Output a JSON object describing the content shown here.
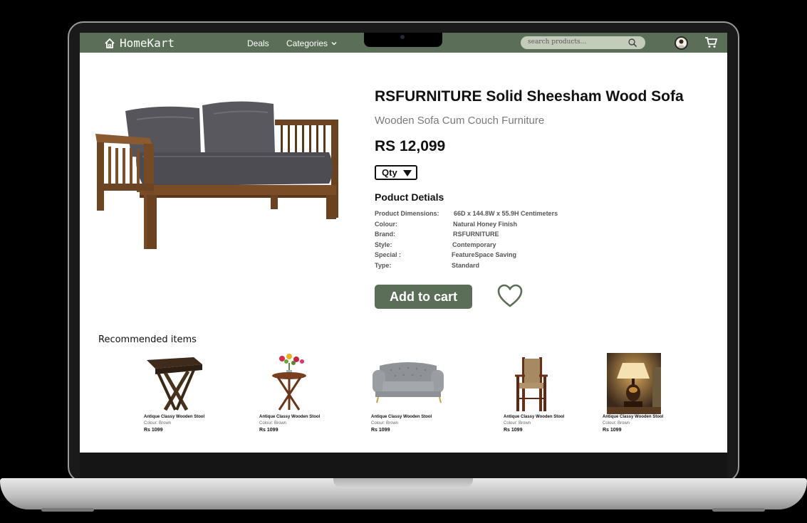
{
  "nav": {
    "brand": "HomeKart",
    "links": [
      "Deals",
      "Categories"
    ],
    "search_placeholder": "search products...",
    "colors": {
      "nav_bg": "#5b6e57",
      "search_bg": "#c3ccbb"
    }
  },
  "product": {
    "title": "RSFURNITURE Solid Sheesham Wood Sofa",
    "subtitle": "Wooden Sofa Cum Couch Furniture",
    "price": "RS 12,099",
    "qty_label": "Qty",
    "details_heading": "Poduct Detials",
    "specs": [
      {
        "label": "Product Dimensions:",
        "value": "66D x 144.8W x 55.9H Centimeters"
      },
      {
        "label": "Colour:",
        "value": "Natural Honey Finish"
      },
      {
        "label": "Brand:",
        "value": "RSFURNITURE"
      },
      {
        "label": "Style:",
        "value": "Contemporary"
      },
      {
        "label": "Special :",
        "value": "FeatureSpace Saving"
      },
      {
        "label": "Type:",
        "value": "Standard"
      }
    ],
    "add_to_cart": "Add to cart"
  },
  "recommended": {
    "title": "Recommended items",
    "items": [
      {
        "name": "Antique Classy Wooden Stool",
        "colour_label": "Colour:",
        "colour": "Brown",
        "price": "Rs 1099",
        "icon": "folding-stool"
      },
      {
        "name": "Antique Classy Wooden Stool",
        "colour_label": "Colour:",
        "colour": "Brown",
        "price": "Rs 1099",
        "icon": "side-table-with-flowers"
      },
      {
        "name": "Antique Classy Wooden Stool",
        "colour_label": "Colour:",
        "colour": "Brown",
        "price": "Rs 1099",
        "icon": "grey-tufted-sofa"
      },
      {
        "name": "Antique Classy Wooden Stool",
        "colour_label": "Colour:",
        "colour": "Brown",
        "price": "Rs 1099",
        "icon": "wooden-armchair"
      },
      {
        "name": "Antique Classy Wooden Stool",
        "colour_label": "Colour:",
        "colour": "Brown",
        "price": "Rs 1099",
        "icon": "table-lamp"
      }
    ]
  }
}
